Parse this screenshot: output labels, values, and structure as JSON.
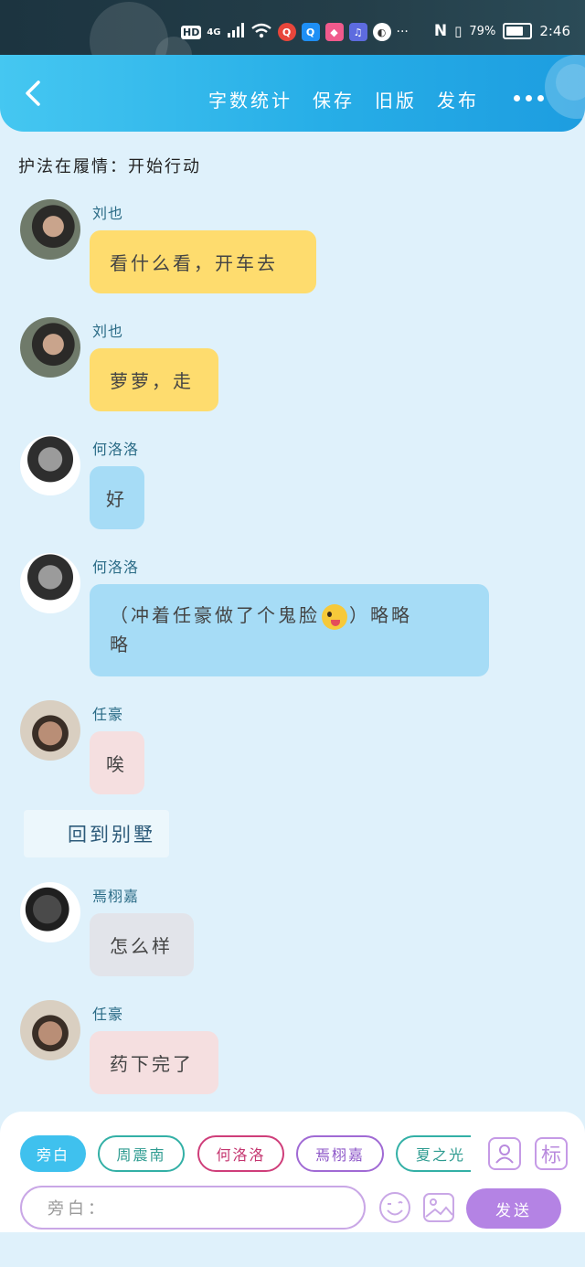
{
  "status_bar": {
    "hd": "HD",
    "signal": "4G",
    "battery_percent": "79%",
    "time": "2:46",
    "overflow": "···"
  },
  "header": {
    "actions": [
      "字数统计",
      "保存",
      "旧版",
      "发布"
    ]
  },
  "chapter": "护法在履情：开始行动",
  "messages": [
    {
      "name": "刘也",
      "text": "看什么看，开车去",
      "color": "yellow"
    },
    {
      "name": "刘也",
      "text": "萝萝，走",
      "color": "yellow"
    },
    {
      "name": "何洛洛",
      "text": "好",
      "color": "blue"
    },
    {
      "name": "何洛洛",
      "text_before": "（冲着任豪做了个鬼脸",
      "text_after": "）略略",
      "text_line2": "略",
      "emoji": "zany-face",
      "color": "blue"
    },
    {
      "name": "任豪",
      "text": "唉",
      "color": "pink"
    },
    {
      "name": "焉栩嘉",
      "text": "怎么样",
      "color": "gray"
    },
    {
      "name": "任豪",
      "text": "药下完了",
      "color": "pink"
    }
  ],
  "scene": "回到别墅",
  "characters": [
    "旁白",
    "周震南",
    "何洛洛",
    "焉栩嘉",
    "夏之光"
  ],
  "input": {
    "placeholder": "旁白："
  },
  "buttons": {
    "send": "发送",
    "tag": "标"
  },
  "colors": {
    "header_accent": "#27aee7",
    "send_button": "#b483e4",
    "active_chip": "#3fc1ee"
  }
}
